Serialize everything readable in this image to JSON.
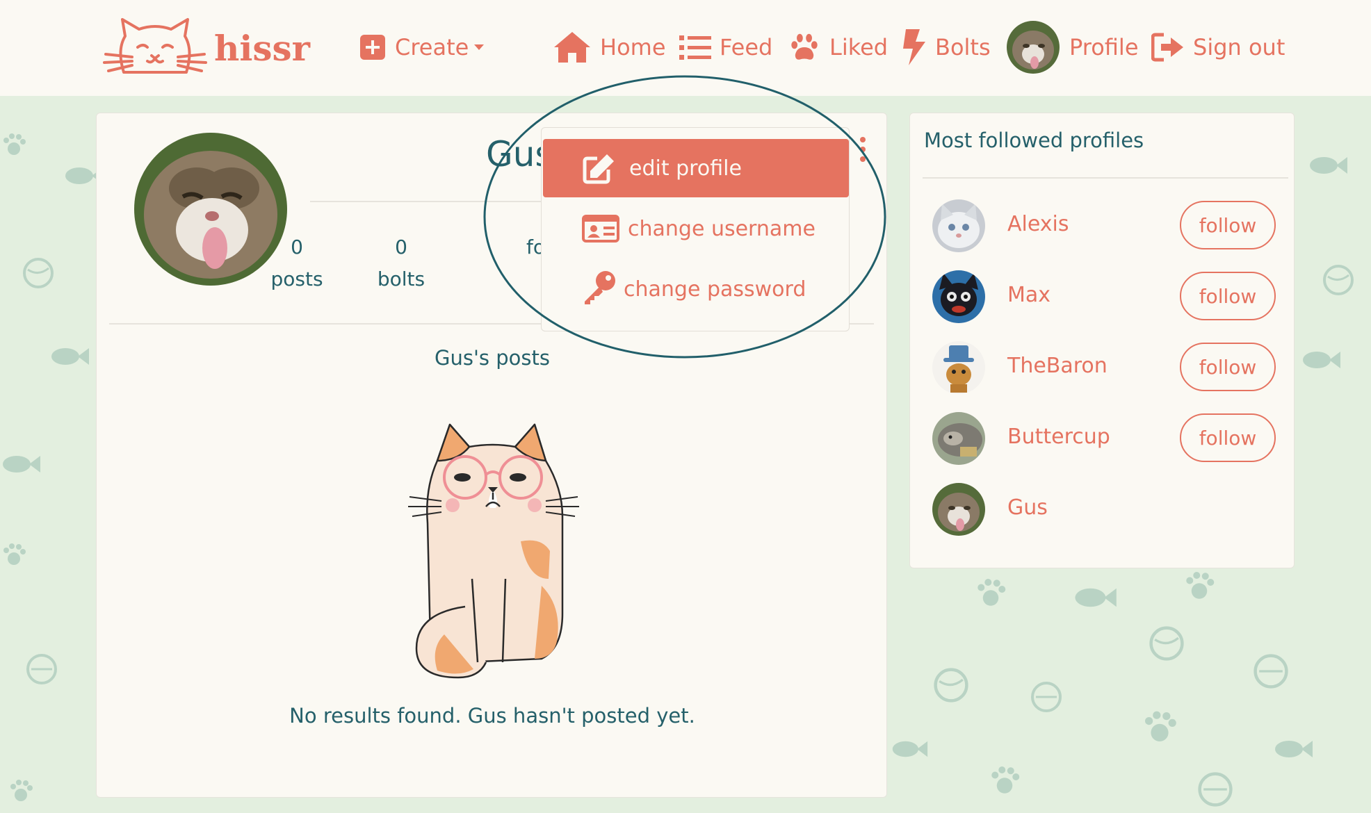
{
  "brand": {
    "name": "hissr"
  },
  "nav": {
    "create": "Create",
    "home": "Home",
    "feed": "Feed",
    "liked": "Liked",
    "bolts": "Bolts",
    "profile": "Profile",
    "sign_out": "Sign out"
  },
  "profile": {
    "name": "Gus",
    "stats": [
      {
        "value": "0",
        "label": "posts"
      },
      {
        "value": "0",
        "label": "bolts"
      },
      {
        "value": "",
        "label": "fo"
      }
    ],
    "posts_heading": "Gus's posts",
    "empty_message": "No results found. Gus hasn't posted yet."
  },
  "dropdown": {
    "items": [
      {
        "label": "edit profile",
        "icon": "edit-icon"
      },
      {
        "label": "change username",
        "icon": "id-card-icon"
      },
      {
        "label": "change password",
        "icon": "key-icon"
      }
    ]
  },
  "sidebar": {
    "title": "Most followed profiles",
    "profiles": [
      {
        "name": "Alexis",
        "follow_label": "follow"
      },
      {
        "name": "Max",
        "follow_label": "follow"
      },
      {
        "name": "TheBaron",
        "follow_label": "follow"
      },
      {
        "name": "Buttercup",
        "follow_label": "follow"
      },
      {
        "name": "Gus"
      }
    ]
  },
  "colors": {
    "accent": "#e57360",
    "text_teal": "#25606a",
    "background": "#e3efdf",
    "card": "#fbf9f3"
  }
}
